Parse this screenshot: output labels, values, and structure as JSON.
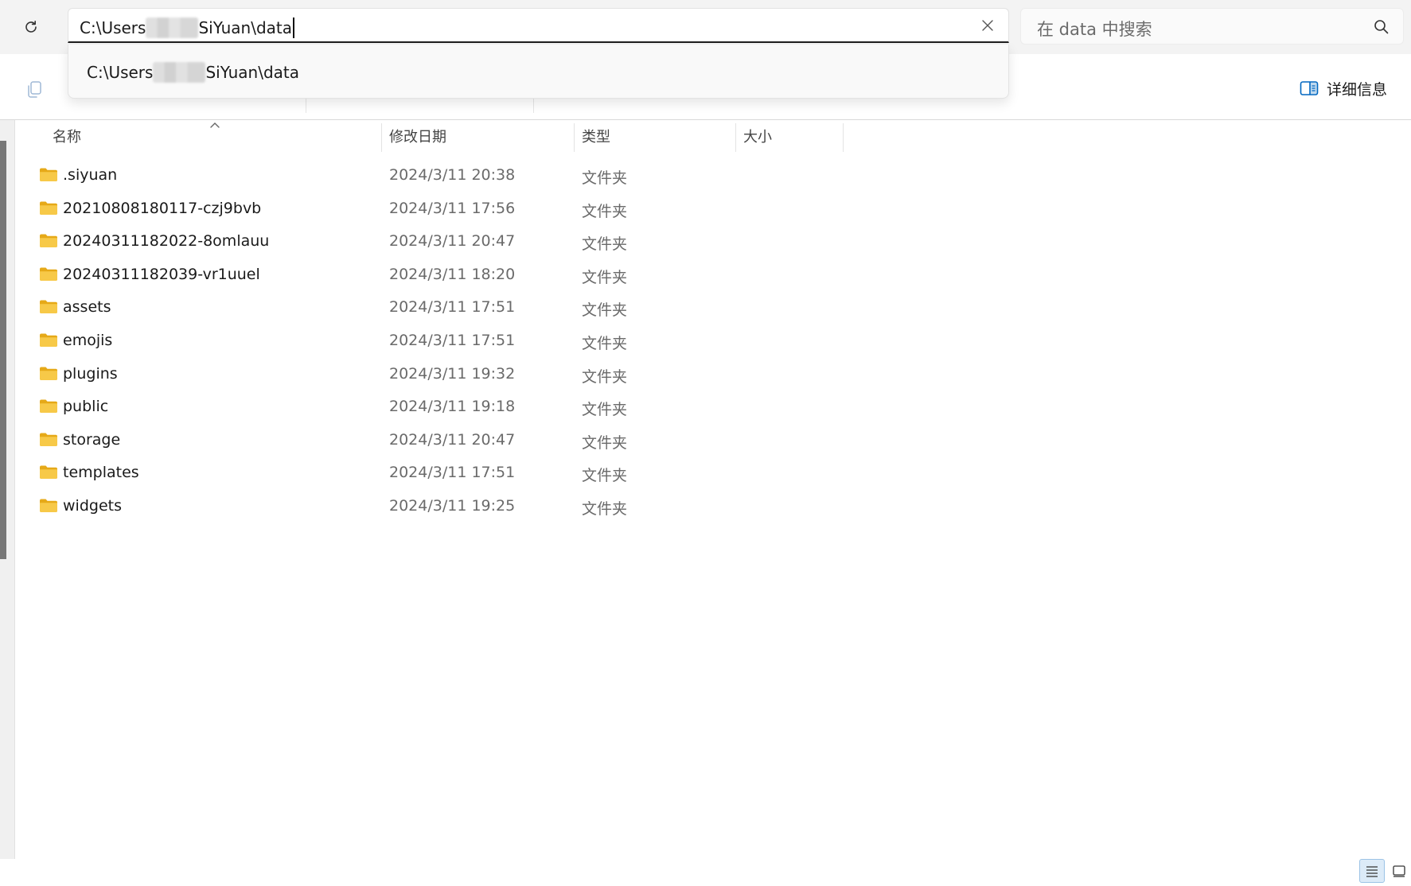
{
  "address": {
    "prefix": "C:\\Users",
    "suffix": "SiYuan\\data"
  },
  "search": {
    "placeholder": "在 data 中搜索"
  },
  "suggestion": {
    "prefix": "C:\\Users",
    "suffix": "SiYuan\\data"
  },
  "toolbar": {
    "details_label": "详细信息"
  },
  "columns": {
    "name": "名称",
    "modified": "修改日期",
    "type": "类型",
    "size": "大小"
  },
  "files": [
    {
      "name": ".siyuan",
      "modified": "2024/3/11 20:38",
      "type": "文件夹"
    },
    {
      "name": "20210808180117-czj9bvb",
      "modified": "2024/3/11 17:56",
      "type": "文件夹"
    },
    {
      "name": "20240311182022-8omlauu",
      "modified": "2024/3/11 20:47",
      "type": "文件夹"
    },
    {
      "name": "20240311182039-vr1uuel",
      "modified": "2024/3/11 18:20",
      "type": "文件夹"
    },
    {
      "name": "assets",
      "modified": "2024/3/11 17:51",
      "type": "文件夹"
    },
    {
      "name": "emojis",
      "modified": "2024/3/11 17:51",
      "type": "文件夹"
    },
    {
      "name": "plugins",
      "modified": "2024/3/11 19:32",
      "type": "文件夹"
    },
    {
      "name": "public",
      "modified": "2024/3/11 19:18",
      "type": "文件夹"
    },
    {
      "name": "storage",
      "modified": "2024/3/11 20:47",
      "type": "文件夹"
    },
    {
      "name": "templates",
      "modified": "2024/3/11 17:51",
      "type": "文件夹"
    },
    {
      "name": "widgets",
      "modified": "2024/3/11 19:25",
      "type": "文件夹"
    }
  ],
  "icons": {
    "refresh": "refresh-icon",
    "clear": "close-icon",
    "search": "search-icon",
    "copy": "copy-icon",
    "details": "details-pane-icon",
    "folder": "folder-icon",
    "sort": "chevron-up-icon",
    "view_list": "details-view-icon",
    "view_tiles": "tiles-view-icon"
  },
  "colors": {
    "folder": "#f7c948",
    "accent": "#0067c0",
    "selected_view": "#dcebf8"
  }
}
